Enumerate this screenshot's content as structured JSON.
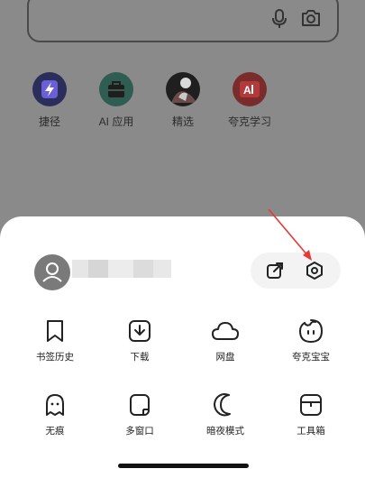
{
  "shortcuts": [
    {
      "label": "捷径",
      "icon": "shortcut-lightning-icon"
    },
    {
      "label": "AI 应用",
      "icon": "ai-apps-bag-icon"
    },
    {
      "label": "精选",
      "icon": "featured-photo-icon"
    },
    {
      "label": "夸克学习",
      "icon": "quark-learning-icon"
    }
  ],
  "menu": {
    "row1": [
      {
        "label": "书签历史",
        "icon": "bookmark-icon"
      },
      {
        "label": "下载",
        "icon": "download-icon"
      },
      {
        "label": "网盘",
        "icon": "cloud-icon"
      },
      {
        "label": "夸克宝宝",
        "icon": "quark-baby-icon"
      }
    ],
    "row2": [
      {
        "label": "无痕",
        "icon": "ghost-icon"
      },
      {
        "label": "多窗口",
        "icon": "multi-window-icon"
      },
      {
        "label": "暗夜模式",
        "icon": "moon-icon"
      },
      {
        "label": "工具箱",
        "icon": "toolbox-icon"
      }
    ]
  },
  "colors": {
    "overlay": "#8a8a8a",
    "sheet": "#ffffff",
    "arrow": "#e53935",
    "pill": "#f3f3f3"
  }
}
